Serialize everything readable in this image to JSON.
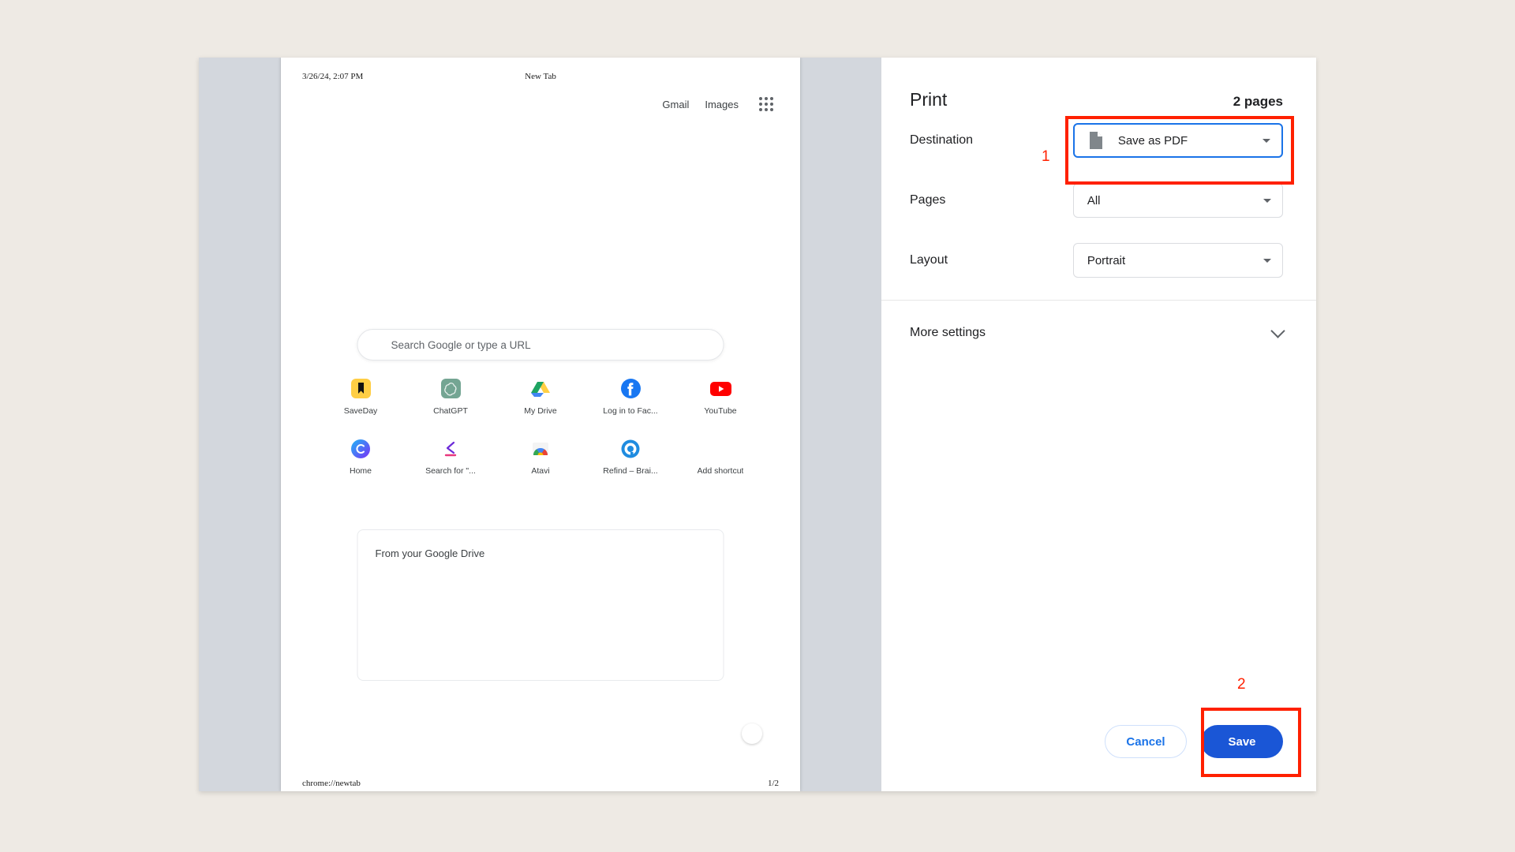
{
  "preview": {
    "header": {
      "date": "3/26/24, 2:07 PM",
      "title": "New Tab"
    },
    "footer": {
      "url": "chrome://newtab",
      "page_number": "1/2"
    },
    "top_links": [
      {
        "label": "Gmail",
        "icon": "gmail-link"
      },
      {
        "label": "Images",
        "icon": "images-link"
      }
    ],
    "apps_icon": "apps-grid-icon",
    "search": {
      "placeholder": "Search Google or type a URL",
      "value": ""
    },
    "shortcuts_row1": [
      {
        "label": "SaveDay",
        "icon": "saveday-icon"
      },
      {
        "label": "ChatGPT",
        "icon": "chatgpt-icon"
      },
      {
        "label": "My Drive",
        "icon": "google-drive-icon"
      },
      {
        "label": "Log in to Fac...",
        "icon": "facebook-icon"
      },
      {
        "label": "YouTube",
        "icon": "youtube-icon"
      }
    ],
    "shortcuts_row2": [
      {
        "label": "Home",
        "icon": "home-c-icon"
      },
      {
        "label": "Search for \"...",
        "icon": "search-for-icon"
      },
      {
        "label": "Atavi",
        "icon": "atavi-icon"
      },
      {
        "label": "Refind – Brai...",
        "icon": "refind-icon"
      },
      {
        "label": "Add shortcut",
        "icon": "add-shortcut-icon"
      }
    ],
    "drive_card": {
      "title": "From your Google Drive"
    },
    "customize_button": "customize-chrome-button"
  },
  "print_dialog": {
    "title": "Print",
    "page_count": "2 pages",
    "rows": [
      {
        "label": "Destination",
        "value": "Save as PDF",
        "icon": "pdf-file-icon",
        "focused": true
      },
      {
        "label": "Pages",
        "value": "All",
        "icon": null,
        "focused": false
      },
      {
        "label": "Layout",
        "value": "Portrait",
        "icon": null,
        "focused": false
      }
    ],
    "more_settings": {
      "label": "More settings",
      "chevron": "chevron-down-icon"
    },
    "buttons": {
      "cancel": "Cancel",
      "save": "Save"
    }
  },
  "annotations": {
    "step1": "1",
    "step2": "2",
    "color": "#ff2000"
  },
  "colors": {
    "accent_blue": "#1a73e8",
    "save_blue": "#1a56d6",
    "annotation_red": "#ff2000",
    "preview_bg": "#d3d7dd",
    "page_bg": "#eeeae4"
  }
}
